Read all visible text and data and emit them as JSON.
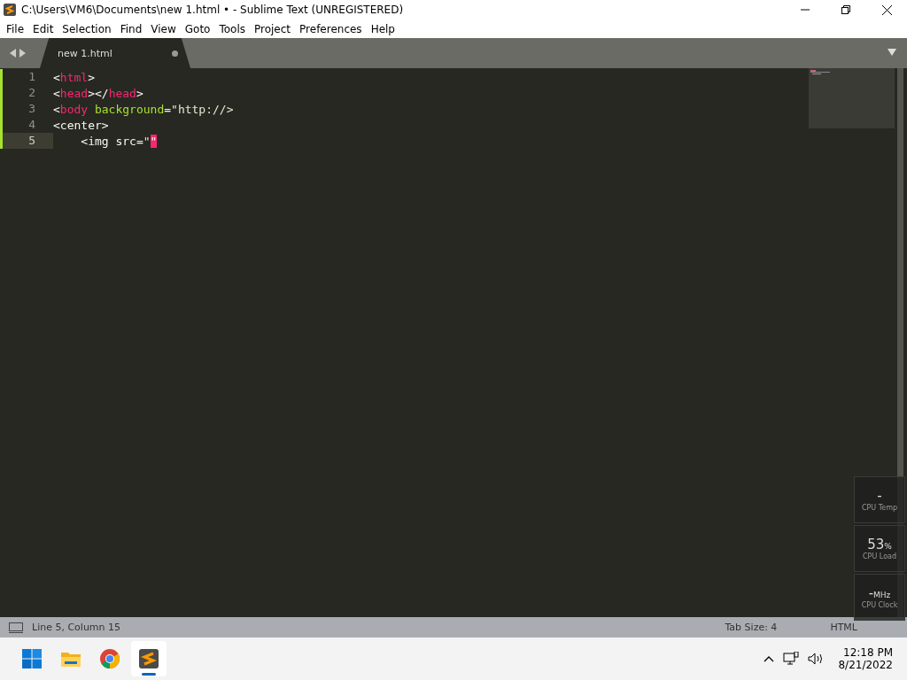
{
  "window": {
    "title": "C:\\Users\\VM6\\Documents\\new 1.html • - Sublime Text (UNREGISTERED)"
  },
  "menu": [
    "File",
    "Edit",
    "Selection",
    "Find",
    "View",
    "Goto",
    "Tools",
    "Project",
    "Preferences",
    "Help"
  ],
  "tabs": [
    {
      "label": "new 1.html",
      "selected": true,
      "modified": true
    }
  ],
  "editor": {
    "lines": [
      {
        "number": "1",
        "modified": true,
        "current": false,
        "tokens": [
          {
            "kind": "punct",
            "text": "<"
          },
          {
            "kind": "tag",
            "text": "html"
          },
          {
            "kind": "punct",
            "text": ">"
          }
        ]
      },
      {
        "number": "2",
        "modified": true,
        "current": false,
        "tokens": [
          {
            "kind": "punct",
            "text": "<"
          },
          {
            "kind": "tag",
            "text": "head"
          },
          {
            "kind": "punct",
            "text": "></"
          },
          {
            "kind": "tag",
            "text": "head"
          },
          {
            "kind": "punct",
            "text": ">"
          }
        ]
      },
      {
        "number": "3",
        "modified": true,
        "current": false,
        "tokens": [
          {
            "kind": "punct",
            "text": "<"
          },
          {
            "kind": "tag",
            "text": "body"
          },
          {
            "kind": "attr",
            "text": " background"
          },
          {
            "kind": "punct",
            "text": "="
          },
          {
            "kind": "string",
            "text": "\"http://>"
          }
        ]
      },
      {
        "number": "4",
        "modified": true,
        "current": false,
        "tokens": [
          {
            "kind": "punct",
            "text": "<center>"
          }
        ]
      },
      {
        "number": "5",
        "modified": true,
        "current": true,
        "tokens": [
          {
            "kind": "punct",
            "text": "    <img src="
          },
          {
            "kind": "string",
            "text": "\""
          },
          {
            "kind": "cursor",
            "text": "\""
          }
        ]
      }
    ]
  },
  "status_bar": {
    "position": "Line 5, Column 15",
    "tab_size": "Tab Size: 4",
    "syntax": "HTML"
  },
  "gadget": [
    {
      "value": "-",
      "label": "CPU Temp"
    },
    {
      "value": "53",
      "unit": "%",
      "label": "CPU Load"
    },
    {
      "value": "-",
      "unit": "MHz",
      "label": "CPU Clock"
    }
  ],
  "taskbar": {
    "apps": [
      {
        "kind": "start",
        "active": false
      },
      {
        "kind": "explorer",
        "active": false
      },
      {
        "kind": "chrome",
        "active": false
      },
      {
        "kind": "sublime",
        "active": true
      }
    ],
    "time": "12:18 PM",
    "date": "8/21/2022"
  }
}
